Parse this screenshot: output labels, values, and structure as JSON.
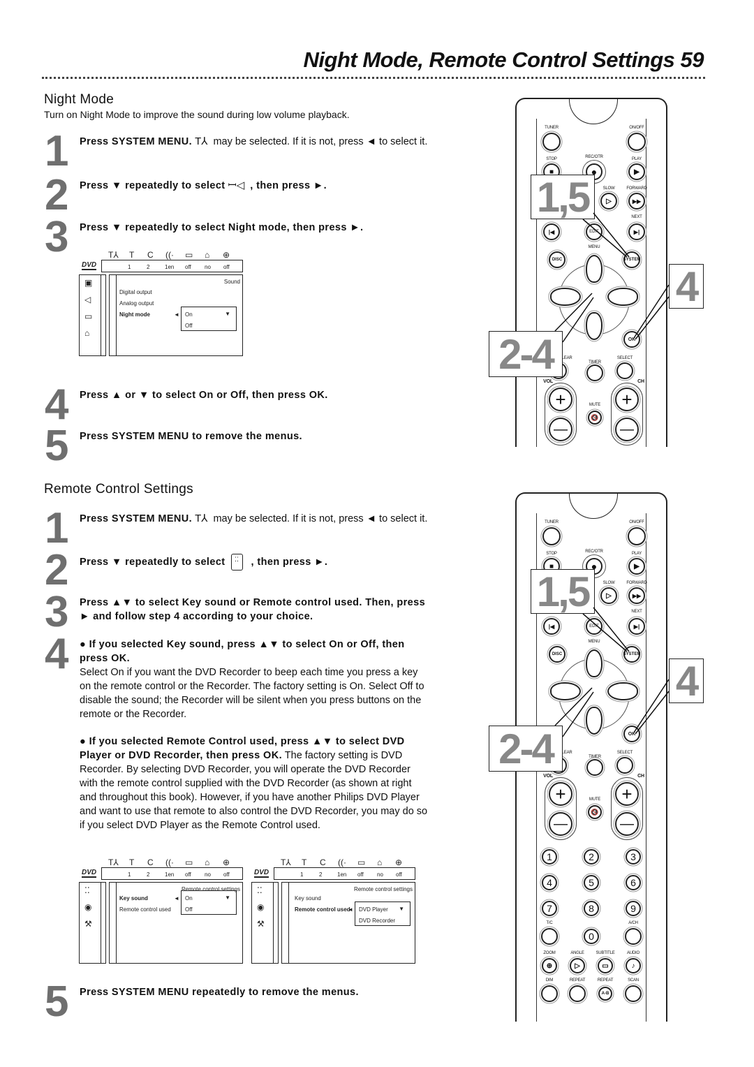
{
  "header": {
    "title": "Night Mode, Remote Control Settings",
    "page": "59"
  },
  "night_mode": {
    "heading": "Night Mode",
    "intro": "Turn on Night Mode to improve the sound during low volume playback.",
    "steps": [
      {
        "num": "1",
        "segs": [
          {
            "b": true,
            "t": "Press SYSTEM MENU."
          },
          {
            "icon": "setup-icon",
            "t": "T⅄"
          },
          {
            "t": "may be selected. If it is not, press ◄ to select it."
          }
        ]
      },
      {
        "num": "2",
        "segs": [
          {
            "b": true,
            "t": "Press ▼ repeatedly to select"
          },
          {
            "icon": "speaker-icon",
            "t": "ꟷ◁"
          },
          {
            "b": true,
            "t": ", then press ►."
          }
        ]
      },
      {
        "num": "3",
        "segs": [
          {
            "b": true,
            "t": "Press ▼ repeatedly to select Night mode, then press ►."
          }
        ]
      },
      {
        "num": "4",
        "segs": [
          {
            "b": true,
            "t": "Press ▲ or ▼ to select On or Off, then press OK."
          }
        ]
      },
      {
        "num": "5",
        "segs": [
          {
            "b": true,
            "t": "Press SYSTEM MENU to remove the menus."
          }
        ]
      }
    ]
  },
  "remote_settings": {
    "heading": "Remote Control Settings",
    "steps": [
      {
        "num": "1",
        "segs": [
          {
            "b": true,
            "t": "Press SYSTEM MENU."
          },
          {
            "icon": "setup-icon",
            "t": "T⅄"
          },
          {
            "t": "may be selected. If it is not, press ◄ to select it."
          }
        ]
      },
      {
        "num": "2",
        "segs": [
          {
            "b": true,
            "t": "Press ▼ repeatedly to select"
          },
          {
            "icon": "remote-settings-icon",
            "t": "⁚⁚"
          },
          {
            "b": true,
            "t": ", then press ►."
          }
        ]
      },
      {
        "num": "3",
        "segs": [
          {
            "b": true,
            "t": "Press ▲▼ to select Key sound or Remote control used. Then, press ► and follow step 4 according to your choice."
          }
        ]
      },
      {
        "num": "4",
        "segs": [
          {
            "b": true,
            "t": "● If you selected Key sound, press ▲▼ to select On or Off, then press OK."
          }
        ]
      },
      {
        "num": "5",
        "segs": [
          {
            "b": true,
            "t": "Press SYSTEM MENU repeatedly to remove the menus."
          }
        ]
      }
    ],
    "keysound_text": "Select On if you want the DVD Recorder to beep each time you press a key on the remote control or the Recorder. The factory setting is On. Select Off to disable the sound; the Recorder will be silent when you press buttons on the remote or the Recorder.",
    "remote_used_bold": "● If you selected Remote Control used, press ▲▼ to select DVD Player or DVD Recorder, then press OK.",
    "remote_used_text": " The factory setting is DVD Recorder. By selecting DVD Recorder, you will operate the DVD Recorder with the remote control supplied with the DVD Recorder (as shown at right and throughout this book). However, if you have another Philips DVD Player and want to use that remote to also control the DVD Recorder, you may do so if you select DVD Player as the Remote Control used."
  },
  "screens": [
    {
      "logo": "DVD",
      "top_icons": [
        "T⅄",
        "T",
        "C",
        "((·",
        "▭",
        "⌂",
        "⊕"
      ],
      "values": [
        "1",
        "2",
        "1en",
        "off",
        "no",
        "off"
      ],
      "side_icons": [
        "▣",
        "◁",
        "▭",
        "⌂"
      ],
      "title": "Sound",
      "items": [
        "Digital output",
        "Analog output",
        "Night mode"
      ],
      "selected": 2,
      "options": [
        "On",
        "Off"
      ]
    },
    {
      "logo": "DVD",
      "top_icons": [
        "T⅄",
        "T",
        "C",
        "((·",
        "▭",
        "⌂",
        "⊕"
      ],
      "values": [
        "1",
        "2",
        "1en",
        "off",
        "no",
        "off"
      ],
      "side_icons": [
        "⁚⁚",
        "◉",
        "⚒"
      ],
      "title": "Remote control settings",
      "items": [
        "Key sound",
        "Remote control used"
      ],
      "selected": 0,
      "options": [
        "On",
        "Off"
      ]
    },
    {
      "logo": "DVD",
      "top_icons": [
        "T⅄",
        "T",
        "C",
        "((·",
        "▭",
        "⌂",
        "⊕"
      ],
      "values": [
        "1",
        "2",
        "1en",
        "off",
        "no",
        "off"
      ],
      "side_icons": [
        "⁚⁚",
        "◉",
        "⚒"
      ],
      "title": "Remote control settings",
      "items": [
        "Key sound",
        "Remote control used"
      ],
      "selected": 1,
      "options": [
        "DVD Player",
        "DVD Recorder"
      ]
    }
  ],
  "remote": {
    "labels": {
      "tuner": "TUNER",
      "onoff": "ON/OFF",
      "stop": "STOP",
      "rec": "REC/OTR",
      "play": "PLAY",
      "slow": "SLOW",
      "forward": "FORWARD",
      "next": "NEXT",
      "edit": "EDIT",
      "menu": "MENU",
      "disc": "DISC",
      "system": "SYSTEM",
      "ok": "OK",
      "clear": "CLEAR",
      "timer": "TIMER",
      "select": "SELECT",
      "vol": "VOL",
      "ch": "CH",
      "mute": "MUTE",
      "tc": "T/C",
      "ach": "A/CH",
      "zoom": "ZOOM",
      "angle": "ANGLE",
      "subtitle": "SUBTITLE",
      "audio": "AUDIO",
      "dim": "DIM",
      "repeat": "REPEAT",
      "repeat_ab": "REPEAT",
      "scan": "SCAN",
      "ab": "A-B"
    },
    "digits": [
      "1",
      "2",
      "3",
      "4",
      "5",
      "6",
      "7",
      "8",
      "9",
      "0"
    ],
    "callouts": {
      "a": "1,5",
      "b": "4",
      "c": "2-4"
    }
  }
}
